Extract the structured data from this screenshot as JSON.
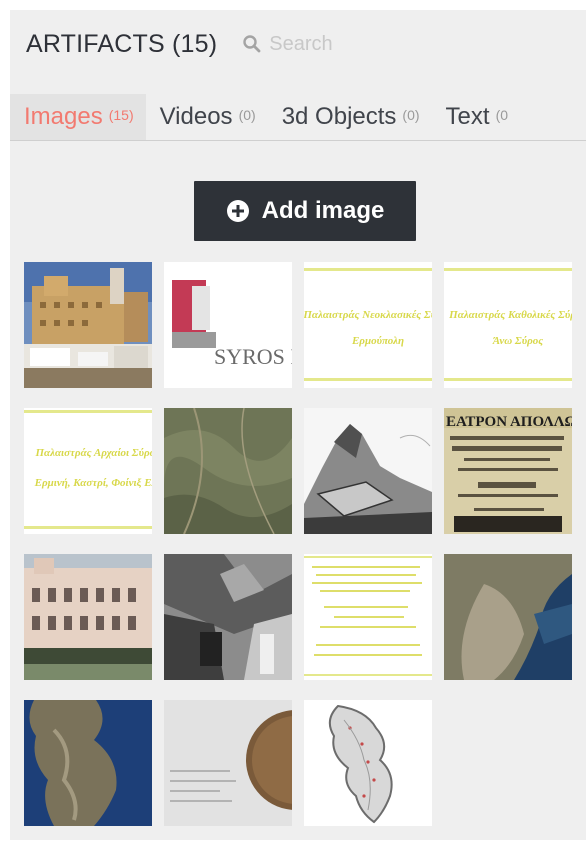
{
  "header": {
    "title": "ARTIFACTS (15)",
    "search_placeholder": "Search"
  },
  "tabs": [
    {
      "label": "Images",
      "count": "(15)",
      "active": true
    },
    {
      "label": "Videos",
      "count": "(0)",
      "active": false
    },
    {
      "label": "3d Objects",
      "count": "(0)",
      "active": false
    },
    {
      "label": "Text",
      "count": "(0",
      "active": false
    }
  ],
  "add_button": {
    "label": "Add image",
    "icon": "plus-circle-icon"
  },
  "thumbnails": [
    {
      "kind": "photo",
      "subject": "monastery building on hill"
    },
    {
      "kind": "logo",
      "text": "SYROS INST"
    },
    {
      "kind": "text-card",
      "lines": [
        "Παλαιστράς Νεοκλασικές Σύρου",
        "Ερμούπολη"
      ]
    },
    {
      "kind": "text-card",
      "lines": [
        "Παλαιστράς Καθολικές Σύρου",
        "Άνω Σύρος"
      ]
    },
    {
      "kind": "text-card",
      "lines": [
        "Παλαιστράς Αρχαίοι Σύρου",
        "Ερμινή, Καστρί, Φοίνιξ Ελλ"
      ]
    },
    {
      "kind": "photo",
      "subject": "aerial terrain"
    },
    {
      "kind": "photo",
      "subject": "engraving of mountain"
    },
    {
      "kind": "poster",
      "text": "ΕΑΤΡΟΝ ΑΠΟΛΛΩ"
    },
    {
      "kind": "photo",
      "subject": "neoclassical building"
    },
    {
      "kind": "photo",
      "subject": "historic street black and white"
    },
    {
      "kind": "document",
      "subject": "text page"
    },
    {
      "kind": "photo",
      "subject": "satellite town and sea"
    },
    {
      "kind": "map",
      "subject": "satellite island map"
    },
    {
      "kind": "document",
      "subject": "page with circular image"
    },
    {
      "kind": "map",
      "subject": "island outline map"
    }
  ],
  "colors": {
    "panel_bg": "#efefef",
    "active_tab_text": "#f27a70",
    "button_bg": "#2e3238",
    "title_text": "#2e3138"
  }
}
